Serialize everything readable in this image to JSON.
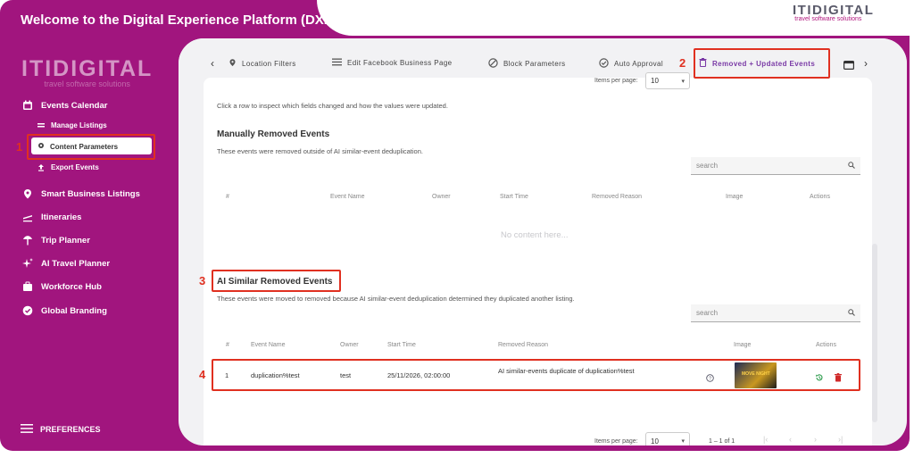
{
  "app": {
    "title": "Welcome to the Digital Experience Platform (DXP)",
    "brand_word": "ITIDIGITAL",
    "brand_tagline": "travel software solutions"
  },
  "sidebar": {
    "logo_word": "ITIDIGITAL",
    "logo_tagline": "travel software solutions",
    "items": [
      {
        "label": "Events Calendar",
        "icon": "calendar-icon"
      },
      {
        "label": "Smart Business Listings",
        "icon": "location-pin-icon"
      },
      {
        "label": "Itineraries",
        "icon": "plane-icon"
      },
      {
        "label": "Trip Planner",
        "icon": "beach-icon"
      },
      {
        "label": "AI Travel Planner",
        "icon": "sparkles-icon"
      },
      {
        "label": "Workforce Hub",
        "icon": "briefcase-icon"
      },
      {
        "label": "Global Branding",
        "icon": "badge-icon"
      }
    ],
    "sub_items": [
      {
        "label": "Manage Listings",
        "icon": "list-icon"
      },
      {
        "label": "Content Parameters",
        "icon": "gear-icon"
      },
      {
        "label": "Export Events",
        "icon": "upload-icon"
      }
    ],
    "preferences_label": "PREFERENCES"
  },
  "annotations": {
    "n1": "1",
    "n2": "2",
    "n3": "3",
    "n4": "4"
  },
  "tabs": [
    {
      "label": "Location Filters",
      "icon": "location-pin-icon"
    },
    {
      "label": "Edit Facebook Business Page",
      "icon": "list-icon"
    },
    {
      "label": "Block Parameters",
      "icon": "block-icon"
    },
    {
      "label": "Auto Approval",
      "icon": "check-circle-icon"
    },
    {
      "label": "Removed + Updated Events",
      "icon": "trash-icon",
      "active": true
    }
  ],
  "top_pager": {
    "items_per_page_label": "Items per page:",
    "value": "10"
  },
  "intro": "Click a row to inspect which fields changed and how the values were updated.",
  "manual": {
    "title": "Manually Removed Events",
    "desc": "These events were removed outside of AI similar-event deduplication.",
    "search_placeholder": "search",
    "headers": [
      "#",
      "Event Name",
      "Owner",
      "Start Time",
      "Removed Reason",
      "Image",
      "Actions"
    ],
    "empty": "No content here..."
  },
  "ai": {
    "title": "AI Similar Removed Events",
    "desc": "These events were moved to removed because AI similar-event deduplication determined they duplicated another listing.",
    "search_placeholder": "search",
    "headers": [
      "#",
      "Event Name",
      "Owner",
      "Start Time",
      "Removed Reason",
      "Image",
      "Actions"
    ],
    "rows": [
      {
        "n": "1",
        "name": "duplication%test",
        "owner": "test",
        "start": "25/11/2026, 02:00:00",
        "reason": "AI similar-events duplicate of duplication%test",
        "thumb_text": "MOVE NIGHT"
      }
    ]
  },
  "pager": {
    "items_per_page_label": "Items per page:",
    "value": "10",
    "range": "1 – 1 of 1"
  },
  "colors": {
    "brand": "#a1157e",
    "accent": "#7a3aa6",
    "annotation": "#e03020"
  }
}
